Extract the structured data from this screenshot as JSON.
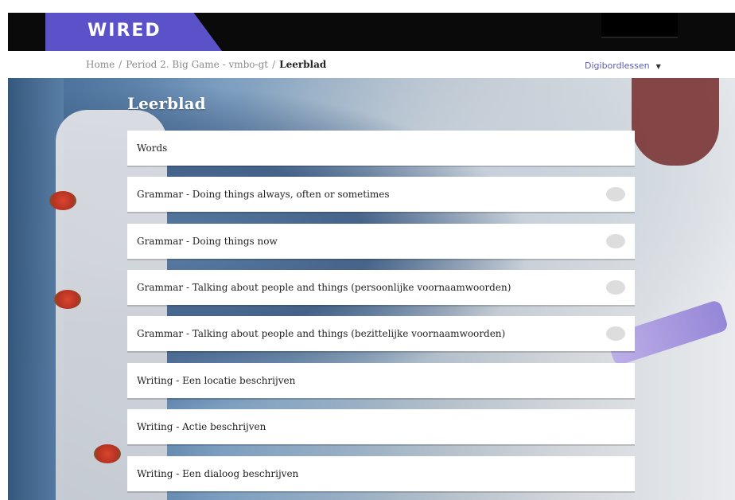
{
  "header": {
    "logo": "WIRED"
  },
  "breadcrumb": {
    "items": [
      "Home",
      "Period 2. Big Game - vmbo-gt"
    ],
    "separator": "/",
    "current": "Leerblad"
  },
  "lessons_menu": {
    "label": "Digibordlessen",
    "caret": "▼"
  },
  "page": {
    "title": "Leerblad"
  },
  "items": [
    {
      "label": "Words",
      "has_status": false
    },
    {
      "label": "Grammar - Doing things always, often or sometimes",
      "has_status": true
    },
    {
      "label": "Grammar - Doing things now",
      "has_status": true
    },
    {
      "label": "Grammar - Talking about people and things (persoonlijke voornaamwoorden)",
      "has_status": true
    },
    {
      "label": "Grammar - Talking about people and things (bezittelijke voornaamwoorden)",
      "has_status": true
    },
    {
      "label": "Writing - Een locatie beschrijven",
      "has_status": false
    },
    {
      "label": "Writing - Actie beschrijven",
      "has_status": false
    },
    {
      "label": "Writing - Een dialoog beschrijven",
      "has_status": false
    }
  ],
  "colors": {
    "brand_purple": "#5b52c9",
    "topbar": "#0a0a0a",
    "status_dot": "#dddddd",
    "link_blue": "#5a5fb0"
  }
}
